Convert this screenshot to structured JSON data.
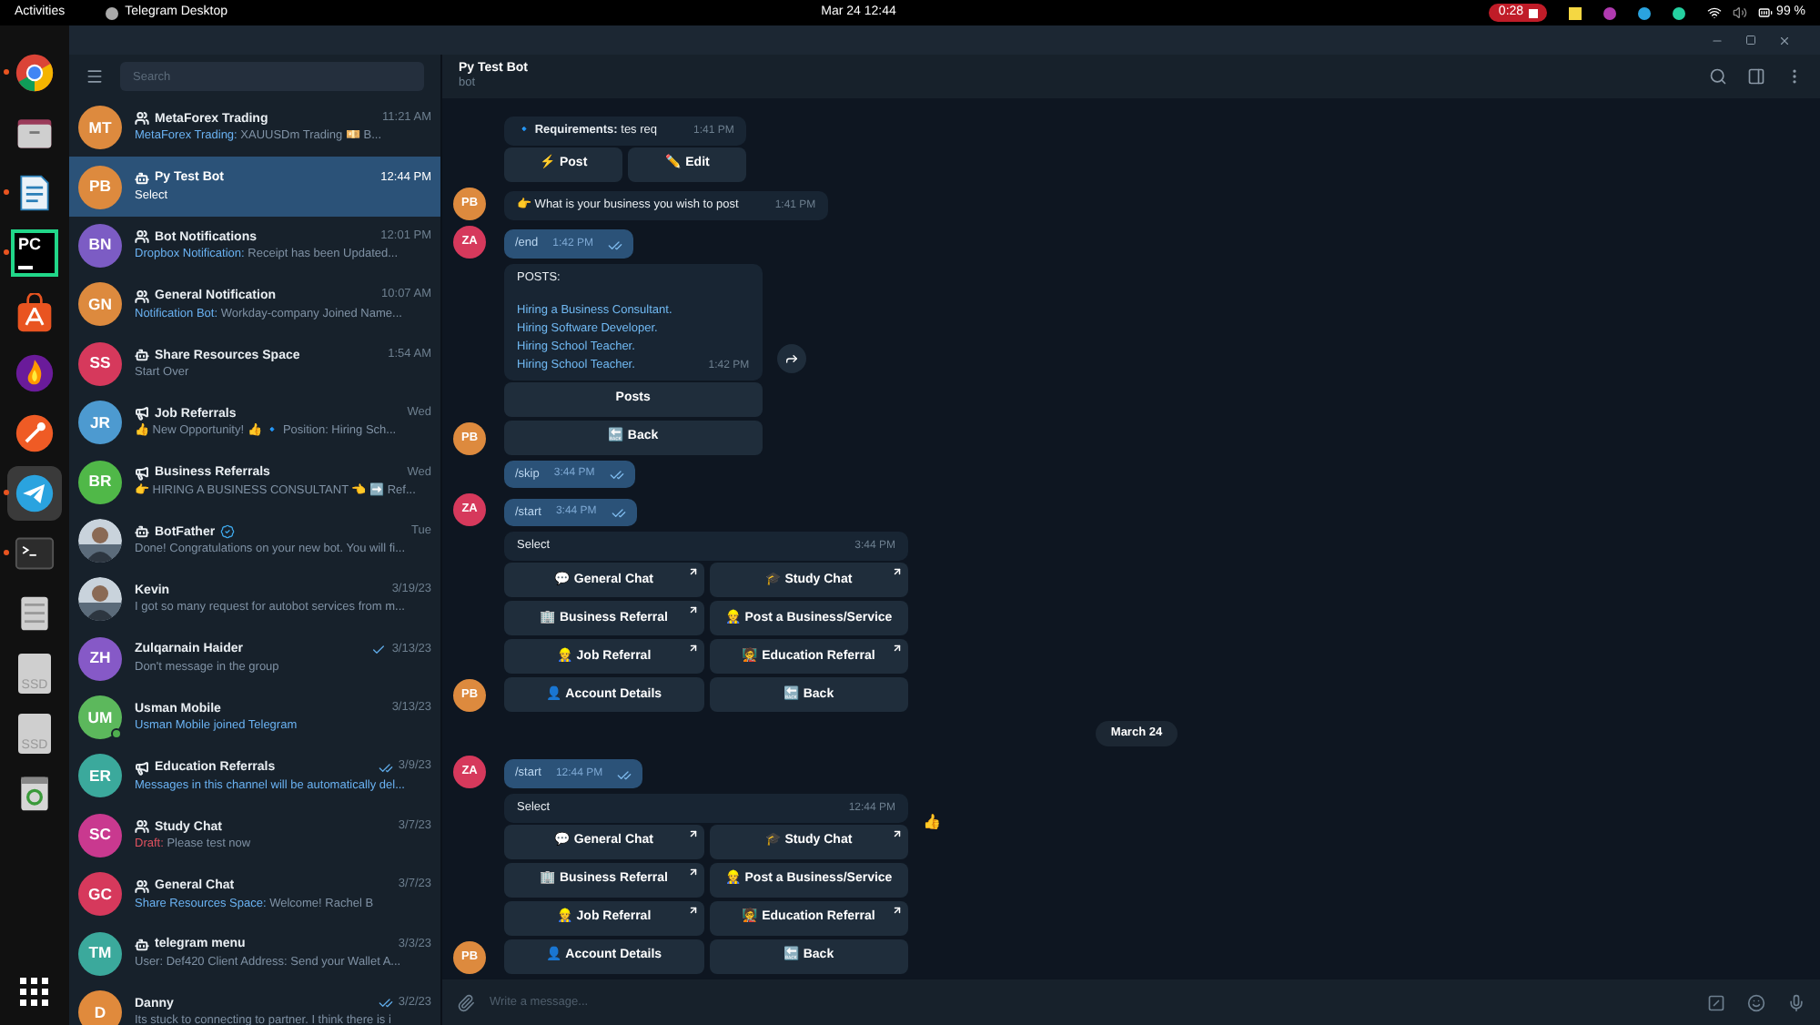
{
  "top_bar": {
    "activities": "Activities",
    "app": "Telegram Desktop",
    "clock": "Mar 24  12:44",
    "recording": "0:28",
    "battery": "99 %"
  },
  "dock": [
    {
      "kind": "browser",
      "running": true,
      "selected": false
    },
    {
      "kind": "folder",
      "running": false,
      "selected": false
    },
    {
      "kind": "document",
      "running": true,
      "selected": false
    },
    {
      "kind": "ide",
      "label": "PC",
      "running": true,
      "selected": false
    },
    {
      "kind": "store",
      "running": false,
      "selected": false
    },
    {
      "kind": "flame",
      "running": false,
      "selected": false
    },
    {
      "kind": "comet",
      "running": false,
      "selected": false
    },
    {
      "kind": "plane",
      "running": true,
      "selected": true
    },
    {
      "kind": "terminal",
      "running": true,
      "selected": false
    },
    {
      "kind": "drive",
      "running": false,
      "selected": false
    },
    {
      "kind": "disk",
      "label": "SSD",
      "running": false,
      "selected": false
    },
    {
      "kind": "disk",
      "label": "SSD",
      "running": false,
      "selected": false
    },
    {
      "kind": "trash",
      "running": false,
      "selected": false
    }
  ],
  "chat_list": {
    "search": {
      "placeholder": "Search"
    },
    "chats": [
      {
        "initials": "MT",
        "color": "#dd8a3e",
        "kind": "group",
        "name": "MetaForex Trading",
        "time": "11:21 AM",
        "prefix": {
          "kind": "sender",
          "text": "MetaForex Trading:"
        },
        "preview": " XAUUSDm Trading 💴 B...",
        "selected": false
      },
      {
        "initials": "PB",
        "color": "#dd8a3e",
        "kind": "bot",
        "name": "Py Test Bot",
        "time": "12:44 PM",
        "preview": "Select",
        "selected": true
      },
      {
        "initials": "BN",
        "color": "#7c5cc4",
        "kind": "group",
        "name": "Bot Notifications",
        "time": "12:01 PM",
        "prefix": {
          "kind": "sender",
          "text": "Dropbox Notification:"
        },
        "preview": " Receipt has been Updated...",
        "selected": false
      },
      {
        "initials": "GN",
        "color": "#dd8a3e",
        "kind": "group",
        "name": "General Notification",
        "time": "10:07 AM",
        "prefix": {
          "kind": "sender",
          "text": "Notification Bot:"
        },
        "preview": " Workday-company Joined  Name...",
        "selected": false
      },
      {
        "initials": "SS",
        "color": "#d6395c",
        "kind": "bot",
        "name": "Share Resources Space",
        "time": "1:54 AM",
        "preview": "Start Over",
        "selected": false
      },
      {
        "initials": "JR",
        "color": "#4d9ad0",
        "kind": "channel",
        "name": "Job Referrals",
        "time": "Wed",
        "preview": "👍 New Opportunity! 👍  🔹 Position: Hiring Sch...",
        "selected": false
      },
      {
        "initials": "BR",
        "color": "#50b848",
        "kind": "channel",
        "name": "Business Referrals",
        "time": "Wed",
        "preview": "👉 HIRING A BUSINESS CONSULTANT 👈 ➡️ Ref...",
        "selected": false
      },
      {
        "photo": true,
        "kind": "bot",
        "name": "BotFather",
        "verified": true,
        "time": "Tue",
        "preview": "Done! Congratulations on your new bot. You will fi...",
        "selected": false
      },
      {
        "photo": true,
        "name": "Kevin",
        "time": "3/19/23",
        "preview": "I got so many request for autobot services from m...",
        "selected": false
      },
      {
        "initials": "ZH",
        "color": "#8659c7",
        "name": "Zulqarnain Haider",
        "time": "3/13/23",
        "read": false,
        "preview": "Don't message in the group",
        "selected": false
      },
      {
        "initials": "UM",
        "color": "#5cb85c",
        "name": "Usman Mobile",
        "time": "3/13/23",
        "online": true,
        "prefix": {
          "kind": "service",
          "text": "Usman Mobile joined Telegram"
        },
        "selected": false
      },
      {
        "initials": "ER",
        "color": "#3ba99c",
        "kind": "channel",
        "name": "Education Referrals",
        "time": "3/9/23",
        "read": true,
        "prefix": {
          "kind": "service",
          "text": "Messages in this channel will be automatically del..."
        },
        "selected": false
      },
      {
        "initials": "SC",
        "color": "#c9398f",
        "kind": "group",
        "name": "Study Chat",
        "time": "3/7/23",
        "prefix": {
          "kind": "draft",
          "text": "Draft:"
        },
        "preview": " Please test now",
        "selected": false
      },
      {
        "initials": "GC",
        "color": "#d6395c",
        "kind": "group",
        "name": "General Chat",
        "time": "3/7/23",
        "prefix": {
          "kind": "sender",
          "text": "Share Resources Space:"
        },
        "preview": " Welcome! Rachel B",
        "selected": false
      },
      {
        "initials": "TM",
        "color": "#3ba99c",
        "kind": "bot",
        "name": "telegram menu",
        "time": "3/3/23",
        "preview": "User: Def420   Client Address: Send your Wallet A...",
        "selected": false
      },
      {
        "initials": "D",
        "color": "#e08a3c",
        "name": "Danny",
        "time": "3/2/23",
        "read": true,
        "preview": "Its stuck to connecting to partner. I think there is i",
        "selected": false
      }
    ]
  },
  "chat": {
    "title": "Py Test Bot",
    "status": "bot",
    "composer": {
      "placeholder": "Write a message..."
    },
    "messages": [
      {
        "kind": "incoming",
        "lines": [
          {
            "kind": "text",
            "text": "🔹 **Requirements:** tes req"
          }
        ],
        "time": "1:41 PM",
        "keyboard": [
          [
            {
              "label": "⚡ Post",
              "arrow": false
            },
            {
              "label": "✏️ Edit",
              "arrow": false
            }
          ]
        ]
      },
      {
        "kind": "incoming",
        "avatar": {
          "initials": "PB",
          "color": "#dd8a3e"
        },
        "lines": [
          {
            "kind": "text",
            "text": "👉 What is your business you wish to post"
          }
        ],
        "time": "1:41 PM"
      },
      {
        "kind": "outgoing",
        "avatar": {
          "initials": "ZA",
          "color": "#d6395c"
        },
        "text": "/end",
        "time": "1:42 PM",
        "read": true
      },
      {
        "kind": "incoming",
        "avatar": {
          "initials": "PB",
          "color": "#dd8a3e"
        },
        "share": true,
        "lines": [
          {
            "kind": "text",
            "text": "POSTS:"
          },
          {
            "kind": "link",
            "text": "Hiring a Business Consultant."
          },
          {
            "kind": "link",
            "text": "Hiring Software Developer."
          },
          {
            "kind": "link",
            "text": "Hiring School Teacher."
          },
          {
            "kind": "link",
            "text": "Hiring School Teacher."
          }
        ],
        "time": "1:42 PM",
        "keyboard": [
          [
            {
              "label": "Posts",
              "arrow": false
            }
          ],
          [
            {
              "label": "🔙 Back",
              "arrow": false
            }
          ]
        ]
      },
      {
        "kind": "outgoing",
        "text": "/skip",
        "time": "3:44 PM",
        "read": true
      },
      {
        "kind": "outgoing",
        "avatar": {
          "initials": "ZA",
          "color": "#d6395c"
        },
        "text": "/start",
        "time": "3:44 PM",
        "read": true
      },
      {
        "kind": "incoming",
        "avatar": {
          "initials": "PB",
          "color": "#dd8a3e"
        },
        "wide": true,
        "lines": [
          {
            "kind": "text",
            "text": "Select"
          }
        ],
        "time": "3:44 PM",
        "keyboard": [
          [
            {
              "label": "💬 General Chat",
              "arrow": true
            },
            {
              "label": "🎓 Study Chat",
              "arrow": true
            }
          ],
          [
            {
              "label": "🏢 Business Referral",
              "arrow": true
            },
            {
              "label": "👷 Post a Business/Service",
              "arrow": false
            }
          ],
          [
            {
              "label": "👷 Job Referral",
              "arrow": true
            },
            {
              "label": "🧑‍🏫 Education Referral",
              "arrow": true
            }
          ],
          [
            {
              "label": "👤 Account Details",
              "arrow": false
            },
            {
              "label": "🔙 Back",
              "arrow": false
            }
          ]
        ]
      },
      {
        "kind": "date",
        "text": "March 24"
      },
      {
        "kind": "outgoing",
        "avatar": {
          "initials": "ZA",
          "color": "#d6395c"
        },
        "text": "/start",
        "time": "12:44 PM",
        "read": true
      },
      {
        "kind": "incoming",
        "avatar": {
          "initials": "PB",
          "color": "#dd8a3e"
        },
        "wide": true,
        "reaction": "👍",
        "lines": [
          {
            "kind": "text",
            "text": "Select"
          }
        ],
        "time": "12:44 PM",
        "keyboard": [
          [
            {
              "label": "💬 General Chat",
              "arrow": true
            },
            {
              "label": "🎓 Study Chat",
              "arrow": true
            }
          ],
          [
            {
              "label": "🏢 Business Referral",
              "arrow": true
            },
            {
              "label": "👷 Post a Business/Service",
              "arrow": false
            }
          ],
          [
            {
              "label": "👷 Job Referral",
              "arrow": true
            },
            {
              "label": "🧑‍🏫 Education Referral",
              "arrow": true
            }
          ],
          [
            {
              "label": "👤 Account Details",
              "arrow": false
            },
            {
              "label": "🔙 Back",
              "arrow": false
            }
          ]
        ]
      }
    ]
  }
}
